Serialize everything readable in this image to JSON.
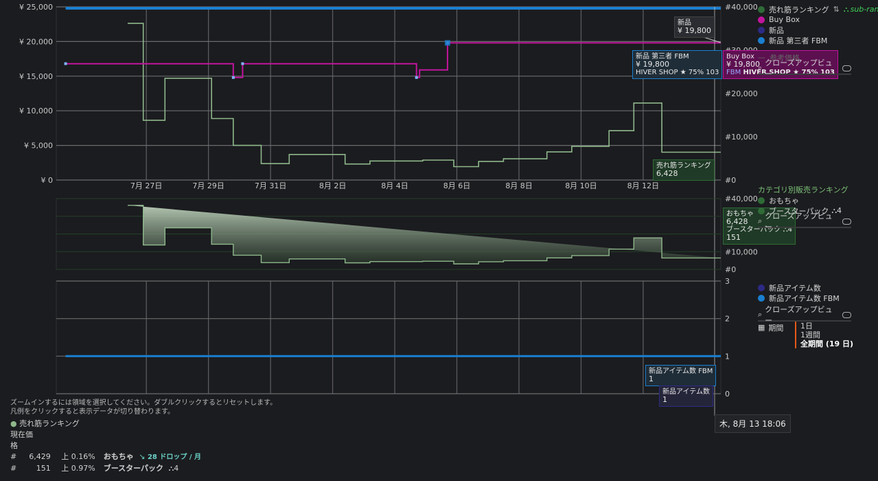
{
  "colors": {
    "salesrank": "#2f6b37",
    "buybox": "#c2149e",
    "new": "#2c2a84",
    "fbm": "#1a7fd0",
    "rank_line": "#8fb88c",
    "rank_fill_top": "#cfe6cc",
    "bg": "#1b1c1f"
  },
  "chart_data": [
    {
      "type": "line",
      "title": "",
      "x_labels": [
        "7月 27日",
        "7月 29日",
        "7月 31日",
        "8月 2日",
        "8月 4日",
        "8月 6日",
        "8月 8日",
        "8月 10日",
        "8月 12日"
      ],
      "x_label_days": [
        1,
        3,
        5,
        7,
        9,
        11,
        13,
        15,
        17
      ],
      "xlim_days": [
        -1.9,
        19.5
      ],
      "ylim_left": [
        0,
        25000
      ],
      "y_ticks_left": [
        "¥ 0",
        "¥ 5,000",
        "¥ 10,000",
        "¥ 15,000",
        "¥ 20,000",
        "¥ 25,000"
      ],
      "ylim_right": [
        0,
        40000
      ],
      "y_ticks_right": [
        "#0",
        "#10,000",
        "#20,000",
        "#30,000",
        "#40,000"
      ],
      "grid": true,
      "series": [
        {
          "name": "Buy Box",
          "axis": "left",
          "days": [
            -1.6,
            3.8,
            3.8,
            4.1,
            4.1,
            9.7,
            9.7,
            9.8,
            9.8,
            10.7,
            10.7,
            19.5
          ],
          "values": [
            16800,
            16800,
            14800,
            14800,
            16800,
            16800,
            14800,
            14800,
            15900,
            15900,
            19800,
            19800
          ]
        },
        {
          "name": "新品 第三者 FBM",
          "axis": "left",
          "days": [
            -1.6,
            19.5
          ],
          "values": [
            24800,
            24800
          ]
        },
        {
          "name": "売れ筋ランキング",
          "axis": "right",
          "days": [
            0.4,
            0.9,
            0.9,
            1.6,
            1.6,
            3.1,
            3.1,
            3.8,
            3.8,
            4.7,
            4.7,
            5.6,
            5.6,
            7.4,
            7.4,
            8.2,
            8.2,
            9.9,
            9.9,
            10.9,
            10.9,
            11.7,
            11.7,
            12.5,
            12.5,
            13.9,
            13.9,
            14.7,
            14.7,
            15.9,
            15.9,
            16.7,
            16.7,
            17.6,
            17.6,
            19.5,
            19.5,
            19.8
          ],
          "values": [
            36200,
            36200,
            13800,
            13800,
            23500,
            23500,
            14200,
            14200,
            8000,
            8000,
            3800,
            3800,
            5900,
            5900,
            3700,
            3700,
            4400,
            4400,
            4600,
            4600,
            3100,
            3100,
            4300,
            4300,
            4900,
            4900,
            6500,
            6500,
            7800,
            7800,
            11400,
            11400,
            17800,
            17800,
            6428,
            6428
          ]
        }
      ],
      "tooltips": {
        "new": {
          "label": "新品",
          "value": "¥ 19,800"
        },
        "fbm": {
          "label": "新品 第三者 FBM",
          "value": "¥ 19,800",
          "seller": "HIVER SHOP  ★ 75%  103"
        },
        "buybox": {
          "label": "Buy Box",
          "value": "¥ 19,800",
          "tag": "FBM",
          "seller": "HIVER SHOP  ★ 75%  103"
        },
        "rank": {
          "label": "売れ筋ランキング",
          "value": "6,428"
        }
      }
    },
    {
      "type": "area",
      "title": "カテゴリ別販売ランキング",
      "ylim_right": [
        0,
        40000
      ],
      "y_ticks_right": [
        "#0",
        "#10,000",
        "#40,000"
      ],
      "series": [
        {
          "name": "おもちゃ",
          "days": [
            0.4,
            0.9,
            0.9,
            1.6,
            1.6,
            3.1,
            3.1,
            3.8,
            3.8,
            4.7,
            4.7,
            5.6,
            5.6,
            7.4,
            7.4,
            8.2,
            8.2,
            9.9,
            9.9,
            10.9,
            10.9,
            11.7,
            11.7,
            12.5,
            12.5,
            13.9,
            13.9,
            14.7,
            14.7,
            15.9,
            15.9,
            16.7,
            16.7,
            17.6,
            17.6,
            19.5,
            19.5,
            19.8
          ],
          "values": [
            36200,
            36200,
            13800,
            13800,
            23500,
            23500,
            14200,
            14200,
            8000,
            8000,
            3800,
            3800,
            5900,
            5900,
            3700,
            3700,
            4400,
            4400,
            4600,
            4600,
            3100,
            3100,
            4300,
            4300,
            4900,
            4900,
            6500,
            6500,
            7800,
            7800,
            11400,
            11400,
            17800,
            17800,
            6428,
            6428
          ]
        }
      ],
      "tooltip": {
        "cat1": "おもちゃ",
        "val1": "6,428",
        "cat2": "ブースターパック",
        "badge": "4",
        "val2": "151"
      }
    },
    {
      "type": "line",
      "title": "",
      "ylim_right": [
        0,
        3
      ],
      "y_ticks_right": [
        "0",
        "1",
        "2",
        "3"
      ],
      "series": [
        {
          "name": "新品アイテム数 FBM",
          "days": [
            -1.6,
            19.5
          ],
          "values": [
            1,
            1
          ]
        }
      ],
      "tooltips": {
        "fbm": {
          "label": "新品アイテム数 FBM",
          "value": "1"
        },
        "new": {
          "label": "新品アイテム数",
          "value": "1"
        }
      }
    }
  ],
  "legend1": {
    "salesrank": "売れ筋ランキング",
    "subrank": "sub-rank",
    "buybox": "Buy Box",
    "new": "新品",
    "fbm": "新品 第三者 FBM",
    "ref": "参考価格",
    "closeup": "クローズアップビュー"
  },
  "legend2": {
    "header": "カテゴリ別販売ランキング",
    "cat1": "おもちゃ",
    "cat2": "ブースターパック",
    "badge": "4",
    "closeup": "クローズアップビュー"
  },
  "legend3": {
    "new_count": "新品アイテム数",
    "fbm_count": "新品アイテム数 FBM",
    "closeup": "クローズアップビュー",
    "period_label": "期間",
    "periods": [
      "1日",
      "1週間",
      "全期間 (19 日)"
    ]
  },
  "crosshair_time": "木, 8月 13 18:06",
  "footer": {
    "hint1": "ズームインするには領域を選択してください。ダブルクリックするとリセットします。",
    "hint2": "凡例をクリックすると表示データが切り替わります。",
    "rank_title": "売れ筋ランキング",
    "current_label": "現在価",
    "price_label": "格",
    "rows": [
      {
        "hash": "#",
        "value": "6,429",
        "change": "上 0.16%",
        "category": "おもちゃ",
        "drops": "28 ドロップ / 月"
      },
      {
        "hash": "#",
        "value": "151",
        "change": "上 0.97%",
        "category": "ブースターパック",
        "badge": "4"
      }
    ]
  }
}
